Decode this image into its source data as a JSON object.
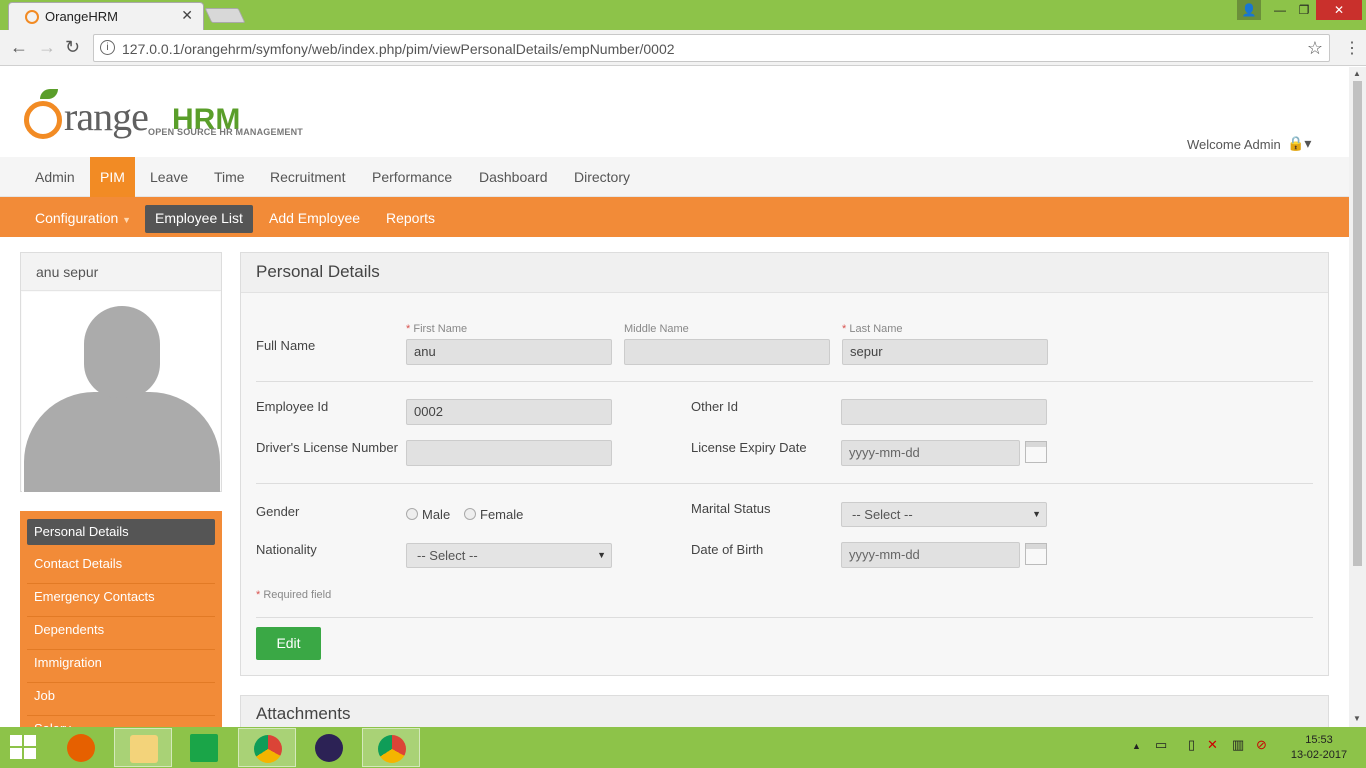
{
  "browser": {
    "tab_title": "OrangeHRM",
    "url": "127.0.0.1/orangehrm/symfony/web/index.php/pim/viewPersonalDetails/empNumber/0002"
  },
  "header": {
    "logo_word": "range",
    "logo_hrm": "HRM",
    "logo_tagline": "OPEN SOURCE HR MANAGEMENT",
    "welcome": "Welcome Admin"
  },
  "main_nav": [
    "Admin",
    "PIM",
    "Leave",
    "Time",
    "Recruitment",
    "Performance",
    "Dashboard",
    "Directory"
  ],
  "sub_nav": {
    "configuration": "Configuration",
    "employee_list": "Employee List",
    "add_employee": "Add Employee",
    "reports": "Reports"
  },
  "profile": {
    "name": "anu sepur"
  },
  "side_menu": [
    "Personal Details",
    "Contact Details",
    "Emergency Contacts",
    "Dependents",
    "Immigration",
    "Job",
    "Salary"
  ],
  "form": {
    "title": "Personal Details",
    "full_name_label": "Full Name",
    "first_name_label": "First Name",
    "middle_name_label": "Middle Name",
    "last_name_label": "Last Name",
    "first_name": "anu",
    "middle_name": "",
    "last_name": "sepur",
    "employee_id_label": "Employee Id",
    "employee_id": "0002",
    "other_id_label": "Other Id",
    "other_id": "",
    "license_label": "Driver's License Number",
    "license": "",
    "license_expiry_label": "License Expiry Date",
    "license_expiry_placeholder": "yyyy-mm-dd",
    "gender_label": "Gender",
    "male": "Male",
    "female": "Female",
    "marital_label": "Marital Status",
    "marital_value": "-- Select --",
    "nationality_label": "Nationality",
    "nationality_value": "-- Select --",
    "dob_label": "Date of Birth",
    "dob_placeholder": "yyyy-mm-dd",
    "required_note": "Required field",
    "edit_button": "Edit"
  },
  "attachments": {
    "title": "Attachments"
  },
  "taskbar": {
    "time": "15:53",
    "date": "13-02-2017"
  },
  "colors": {
    "brand_orange": "#f28b24",
    "green": "#8dc349",
    "button_green": "#3aa845"
  }
}
